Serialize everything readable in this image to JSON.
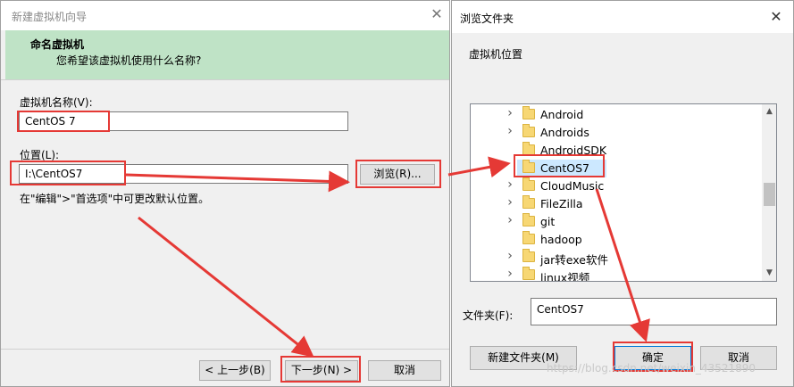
{
  "wizard": {
    "title": "新建虚拟机向导",
    "close_glyph": "✕",
    "header_title": "命名虚拟机",
    "header_subtitle": "您希望该虚拟机使用什么名称?",
    "name_label": "虚拟机名称(V):",
    "name_value": "CentOS 7",
    "location_label": "位置(L):",
    "location_value": "I:\\CentOS7",
    "browse_button": "浏览(R)...",
    "hint": "在\"编辑\">\"首选项\"中可更改默认位置。",
    "back_button": "< 上一步(B)",
    "next_button": "下一步(N) >",
    "cancel_button": "取消"
  },
  "browse": {
    "title": "浏览文件夹",
    "close_glyph": "✕",
    "section_label": "虚拟机位置",
    "tree": [
      {
        "label": "Android",
        "expandable": true
      },
      {
        "label": "Androids",
        "expandable": true
      },
      {
        "label": "AndroidSDK",
        "expandable": false
      },
      {
        "label": "CentOS7",
        "expandable": false,
        "selected": true
      },
      {
        "label": "CloudMusic",
        "expandable": true
      },
      {
        "label": "FileZilla",
        "expandable": true
      },
      {
        "label": "git",
        "expandable": true
      },
      {
        "label": "hadoop",
        "expandable": false
      },
      {
        "label": "jar转exe软件",
        "expandable": true
      },
      {
        "label": "linux视频",
        "expandable": true
      }
    ],
    "folder_label": "文件夹(F):",
    "folder_value": "CentOS7",
    "new_folder_button": "新建文件夹(M)",
    "ok_button": "确定",
    "cancel_button": "取消"
  },
  "watermark": "https://blog.csdn.net/weixin_43521890",
  "colors": {
    "header_green": "#bfe3c6",
    "annotation_red": "#e53935",
    "folder_yellow": "#f7d774"
  }
}
